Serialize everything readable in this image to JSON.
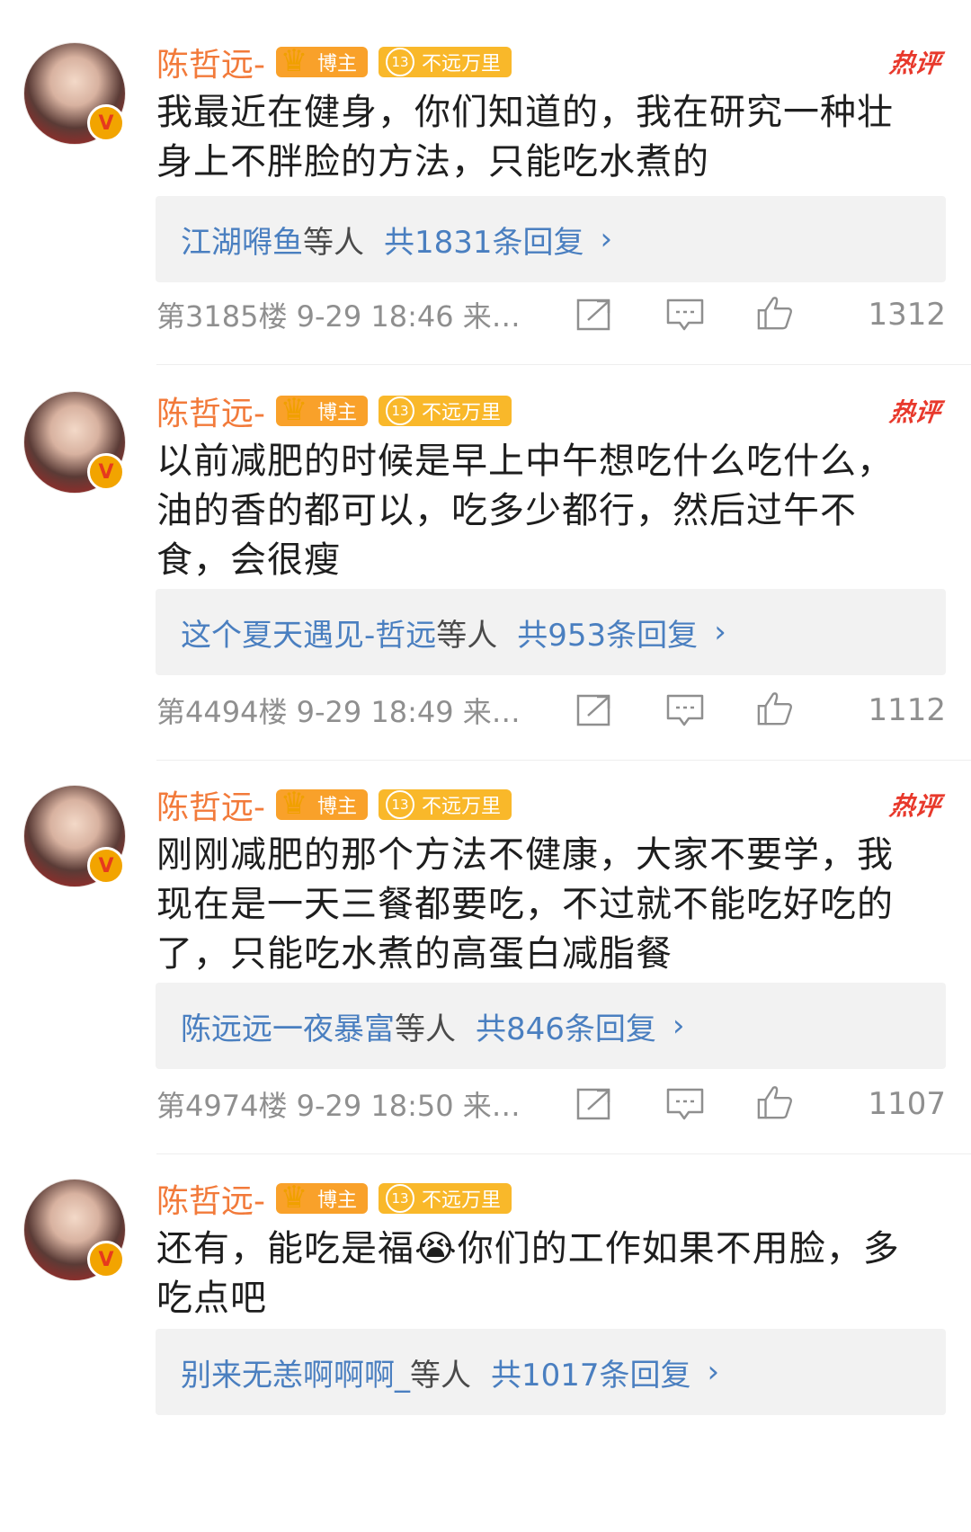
{
  "colors": {
    "username": "#f27a3a",
    "link": "#4a7fc0",
    "hot": "#e8392c",
    "meta": "#8f8f8f"
  },
  "comments": [
    {
      "username": "陈哲远-",
      "badge_role": "博主",
      "badge_level_num": "13",
      "badge_level_text": "不远万里",
      "hot_tag": "热评",
      "content": "我最近在健身，你们知道的，我在研究一种壮\n身上不胖脸的方法，只能吃水煮的",
      "reply_names": "江湖嘚鱼",
      "reply_etal": "等人",
      "reply_count": "共1831条回复",
      "meta": "第3185楼  9-29 18:46  来…",
      "likes": "1312",
      "icons": [
        "share-icon",
        "comment-icon",
        "like-icon"
      ]
    },
    {
      "username": "陈哲远-",
      "badge_role": "博主",
      "badge_level_num": "13",
      "badge_level_text": "不远万里",
      "hot_tag": "热评",
      "content": "以前减肥的时候是早上中午想吃什么吃什么，\n油的香的都可以，吃多少都行，然后过午不\n食，会很瘦",
      "reply_names": "这个夏天遇见-哲远",
      "reply_etal": "等人",
      "reply_count": "共953条回复",
      "meta": "第4494楼  9-29 18:49  来…",
      "likes": "1112",
      "icons": [
        "share-icon",
        "comment-icon",
        "like-icon"
      ]
    },
    {
      "username": "陈哲远-",
      "badge_role": "博主",
      "badge_level_num": "13",
      "badge_level_text": "不远万里",
      "hot_tag": "热评",
      "content": "刚刚减肥的那个方法不健康，大家不要学，我\n现在是一天三餐都要吃，不过就不能吃好吃的\n了，只能吃水煮的高蛋白减脂餐",
      "reply_names": "陈远远一夜暴富",
      "reply_etal": "等人",
      "reply_count": "共846条回复",
      "meta": "第4974楼  9-29 18:50  来…",
      "likes": "1107",
      "icons": [
        "share-icon",
        "comment-icon",
        "like-icon"
      ]
    },
    {
      "username": "陈哲远-",
      "badge_role": "博主",
      "badge_level_num": "13",
      "badge_level_text": "不远万里",
      "hot_tag": "",
      "content": "还有，能吃是福😭你们的工作如果不用脸，多\n吃点吧",
      "reply_names": "别来无恙啊啊啊_",
      "reply_etal": "等人",
      "reply_count": "共1017条回复",
      "meta": "",
      "likes": "",
      "icons": []
    }
  ]
}
